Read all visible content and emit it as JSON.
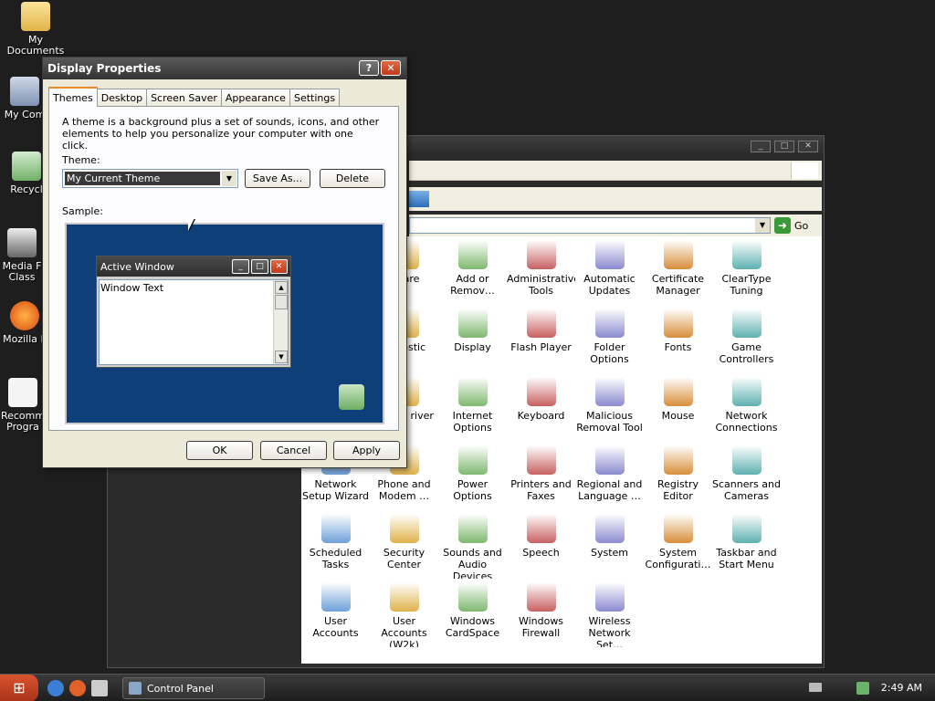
{
  "desktop": {
    "icons": [
      {
        "label": "My Documents"
      },
      {
        "label": "My Com"
      },
      {
        "label": "Recycl"
      },
      {
        "label": "Media F Class"
      },
      {
        "label": "Mozilla F"
      },
      {
        "label": "Recomm Progra"
      }
    ]
  },
  "control_panel": {
    "go_label": "Go",
    "items": [
      {
        "label": "",
        "icon": "hidden"
      },
      {
        "label": "dware",
        "icon": "hardware-icon"
      },
      {
        "label": "Add or Remov…",
        "icon": "add-remove-icon"
      },
      {
        "label": "Administrative Tools",
        "icon": "admin-tools-icon"
      },
      {
        "label": "Automatic Updates",
        "icon": "globe-icon"
      },
      {
        "label": "Certificate Manager",
        "icon": "certificate-icon"
      },
      {
        "label": "ClearType Tuning",
        "icon": "cleartype-icon"
      },
      {
        "label": "",
        "icon": "hidden"
      },
      {
        "label": "ctX ostic",
        "icon": "directx-icon"
      },
      {
        "label": "Display",
        "icon": "display-icon"
      },
      {
        "label": "Flash Player",
        "icon": "flash-icon"
      },
      {
        "label": "Folder Options",
        "icon": "folder-icon"
      },
      {
        "label": "Fonts",
        "icon": "fonts-icon"
      },
      {
        "label": "Game Controllers",
        "icon": "gamepad-icon"
      },
      {
        "label": "",
        "icon": "hidden"
      },
      {
        "label": "Virtual river",
        "icon": "virtual-driver-icon"
      },
      {
        "label": "Internet Options",
        "icon": "internet-icon"
      },
      {
        "label": "Keyboard",
        "icon": "keyboard-icon"
      },
      {
        "label": "Malicious Removal Tool",
        "icon": "malicious-removal-icon"
      },
      {
        "label": "Mouse",
        "icon": "mouse-icon"
      },
      {
        "label": "Network Connections",
        "icon": "network-icon"
      },
      {
        "label": "Network Setup Wizard",
        "icon": "network-wizard-icon"
      },
      {
        "label": "Phone and Modem …",
        "icon": "phone-icon"
      },
      {
        "label": "Power Options",
        "icon": "power-icon"
      },
      {
        "label": "Printers and Faxes",
        "icon": "printer-icon"
      },
      {
        "label": "Regional and Language …",
        "icon": "regional-icon"
      },
      {
        "label": "Registry Editor",
        "icon": "registry-icon"
      },
      {
        "label": "Scanners and Cameras",
        "icon": "scanner-icon"
      },
      {
        "label": "Scheduled Tasks",
        "icon": "scheduled-icon"
      },
      {
        "label": "Security Center",
        "icon": "shield-icon"
      },
      {
        "label": "Sounds and Audio Devices",
        "icon": "speaker-icon"
      },
      {
        "label": "Speech",
        "icon": "speech-icon"
      },
      {
        "label": "System",
        "icon": "system-icon"
      },
      {
        "label": "System Configurati…",
        "icon": "sysconfig-icon"
      },
      {
        "label": "Taskbar and Start Menu",
        "icon": "taskbar-icon"
      },
      {
        "label": "User Accounts",
        "icon": "users-icon"
      },
      {
        "label": "User Accounts (W2k)",
        "icon": "users-key-icon"
      },
      {
        "label": "Windows CardSpace",
        "icon": "cardspace-icon"
      },
      {
        "label": "Windows Firewall",
        "icon": "firewall-icon"
      },
      {
        "label": "Wireless Network Set…",
        "icon": "wireless-icon"
      }
    ]
  },
  "dialog": {
    "title": "Display Properties",
    "help_glyph": "?",
    "close_glyph": "✕",
    "tabs": [
      "Themes",
      "Desktop",
      "Screen Saver",
      "Appearance",
      "Settings"
    ],
    "description": "A theme is a background plus a set of sounds, icons, and other elements to help you personalize your computer with one click.",
    "theme_label": "Theme:",
    "theme_value": "My Current Theme",
    "save_as": "Save As...",
    "delete": "Delete",
    "sample_label": "Sample:",
    "sample": {
      "window_title": "Active Window",
      "window_text": "Window Text"
    },
    "ok": "OK",
    "cancel": "Cancel",
    "apply": "Apply"
  },
  "taskbar": {
    "task_label": "Control Panel",
    "clock": "2:49 AM"
  },
  "colors": {
    "sample_background": "#0f3f78",
    "tab_active_accent": "#e68b2c",
    "close_button": "#c0391b"
  }
}
